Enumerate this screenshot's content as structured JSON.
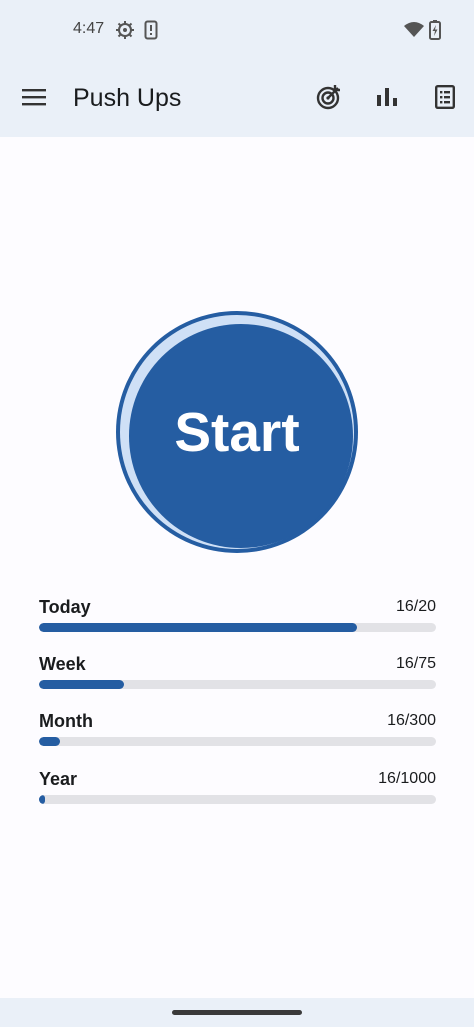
{
  "status_bar": {
    "time": "4:47"
  },
  "app_bar": {
    "title": "Push Ups"
  },
  "start_button": {
    "label": "Start"
  },
  "stats": [
    {
      "label": "Today",
      "value": "16/20",
      "progress": 0.8
    },
    {
      "label": "Week",
      "value": "16/75",
      "progress": 0.2133
    },
    {
      "label": "Month",
      "value": "16/300",
      "progress": 0.0533
    },
    {
      "label": "Year",
      "value": "16/1000",
      "progress": 0.016
    }
  ],
  "colors": {
    "accent": "#255da2",
    "track": "#e2e2e6",
    "bar_background": "#eaf0f8"
  }
}
